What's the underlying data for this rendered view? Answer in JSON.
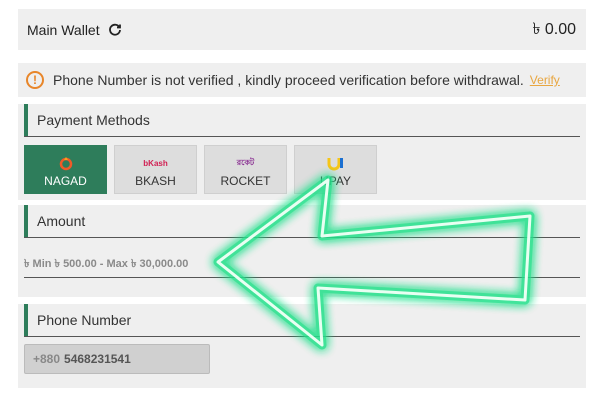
{
  "wallet": {
    "label": "Main Wallet",
    "balance": "৳ 0.00"
  },
  "notice": {
    "message": "Phone Number is not verified , kindly proceed verification before withdrawal.",
    "link": "Verify"
  },
  "payment": {
    "title": "Payment Methods",
    "methods": [
      {
        "label": "NAGAD",
        "logo": "nagad-logo",
        "active": true
      },
      {
        "label": "BKASH",
        "logo": "bkash-logo",
        "logo_text": "bKash",
        "active": false
      },
      {
        "label": "ROCKET",
        "logo": "rocket-logo",
        "logo_text": "রকেট",
        "active": false
      },
      {
        "label": "UPAY",
        "logo": "upay-logo",
        "active": false
      }
    ]
  },
  "amount": {
    "title": "Amount",
    "placeholder": "৳ Min ৳ 500.00 - Max ৳ 30,000.00"
  },
  "phone": {
    "title": "Phone Number",
    "prefix": "+880",
    "value": "5468231541"
  },
  "colors": {
    "accent": "#2e7d5b",
    "warning": "#e8862a",
    "arrow_glow": "#22e08a"
  }
}
